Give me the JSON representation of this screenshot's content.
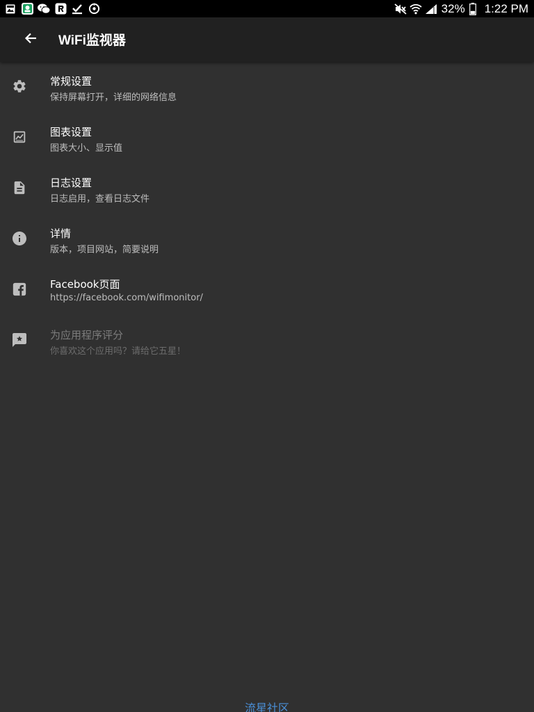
{
  "status_bar": {
    "left_icons": [
      "gallery-notification-icon",
      "app-notification-icon",
      "wechat-icon",
      "reader-app-icon",
      "download-done-icon",
      "sync-icon"
    ],
    "right_icons": [
      "mute-icon",
      "wifi-icon",
      "cellular-signal-icon",
      "battery-icon"
    ],
    "battery_percent": "32%",
    "time": "1:22 PM"
  },
  "app_bar": {
    "title": "WiFi监视器",
    "back_icon": "arrow-back-icon"
  },
  "settings": {
    "items": [
      {
        "title": "常规设置",
        "summary": "保持屏幕打开，详细的网络信息",
        "icon": "gear-icon",
        "enabled": true
      },
      {
        "title": "图表设置",
        "summary": "图表大小、显示值",
        "icon": "chart-icon",
        "enabled": true
      },
      {
        "title": "日志设置",
        "summary": "日志启用，查看日志文件",
        "icon": "document-icon",
        "enabled": true
      },
      {
        "title": "详情",
        "summary": "版本，项目网站，简要说明",
        "icon": "info-icon",
        "enabled": true
      },
      {
        "title": "Facebook页面",
        "summary": "https://facebook.com/wifimonitor/",
        "icon": "facebook-icon",
        "enabled": true
      },
      {
        "title": "为应用程序评分",
        "summary": "你喜欢这个应用吗？请给它五星！",
        "icon": "rate-star-icon",
        "enabled": false
      }
    ]
  },
  "watermark": "流星社区",
  "colors": {
    "background": "#303030",
    "app_bar": "#212121",
    "status_bar": "#000000",
    "primary_text": "#ffffff",
    "secondary_text": "#bdbdbd",
    "disabled_text": "#7c7c7c",
    "icon": "#bdbdbd",
    "watermark": "#4a90d9"
  }
}
